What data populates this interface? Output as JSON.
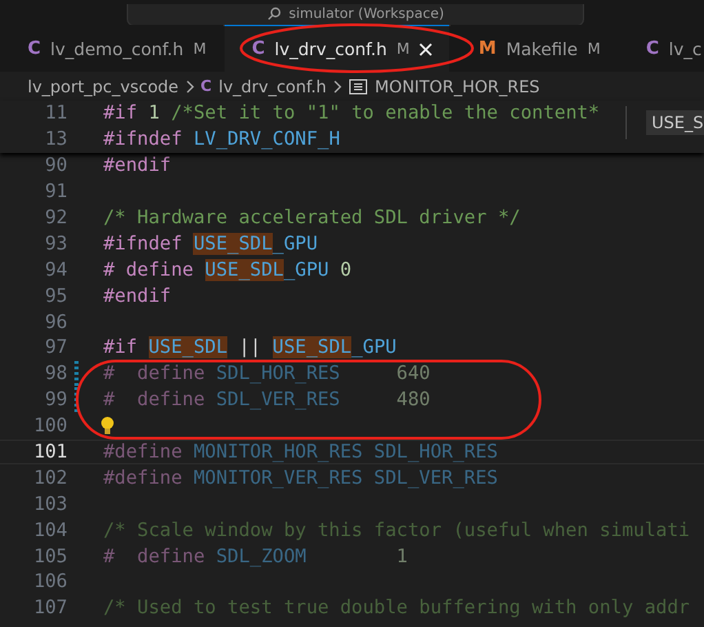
{
  "title_bar": {
    "search_text": "simulator (Workspace)"
  },
  "tabs": [
    {
      "icon": "C",
      "color": "#a074c4",
      "label": "lv_demo_conf.h",
      "status": "M",
      "selected": false
    },
    {
      "icon": "C",
      "color": "#a074c4",
      "label": "lv_drv_conf.h",
      "status": "M",
      "selected": true
    },
    {
      "icon": "M",
      "color": "#e37933",
      "label": "Makefile",
      "status": "M",
      "selected": false
    },
    {
      "icon": "C",
      "color": "#a074c4",
      "label": "lv_c",
      "selected": false
    }
  ],
  "breadcrumb": [
    {
      "kind": "folder",
      "label": "lv_port_pc_vscode"
    },
    {
      "kind": "file",
      "icon": "C",
      "label": "lv_drv_conf.h"
    },
    {
      "kind": "symbol",
      "label": "MONITOR_HOR_RES"
    }
  ],
  "sticky_lines": [
    {
      "number": "11",
      "tokens": [
        {
          "kind": "directive",
          "text": "#if"
        },
        {
          "kind": "number",
          "text": " 1"
        },
        {
          "kind": "comment",
          "text": " /*Set it to \"1\" to enable the content*"
        }
      ]
    },
    {
      "number": "13",
      "tokens": [
        {
          "kind": "directive",
          "text": "#ifndef"
        },
        {
          "kind": "macro",
          "text": " LV_DRV_CONF_H"
        }
      ]
    }
  ],
  "hover_widget": {
    "text": "USE_S"
  },
  "lines": [
    {
      "number": "90",
      "tokens": [
        {
          "kind": "directive",
          "text": "#endif"
        }
      ]
    },
    {
      "number": "91"
    },
    {
      "number": "92",
      "tokens": [
        {
          "kind": "comment",
          "text": "/* Hardware accelerated SDL driver */"
        }
      ]
    },
    {
      "number": "93",
      "tokens": [
        {
          "kind": "directive",
          "text": "#ifndef "
        },
        {
          "kind": "macro",
          "text": "USE_SDL",
          "highlight": true
        },
        {
          "kind": "macro",
          "text": "_GPU"
        }
      ]
    },
    {
      "number": "94",
      "tokens": [
        {
          "kind": "directive",
          "text": "# define "
        },
        {
          "kind": "macro",
          "text": "USE_SDL",
          "highlight": true
        },
        {
          "kind": "macro",
          "text": "_GPU "
        },
        {
          "kind": "number",
          "text": "0"
        }
      ]
    },
    {
      "number": "95",
      "tokens": [
        {
          "kind": "directive",
          "text": "#endif"
        }
      ]
    },
    {
      "number": "96"
    },
    {
      "number": "97",
      "tokens": [
        {
          "kind": "directive",
          "text": "#if "
        },
        {
          "kind": "macro",
          "text": "USE_SDL",
          "highlight": true
        },
        {
          "kind": "text",
          "text": " || "
        },
        {
          "kind": "macro",
          "text": "USE_SDL",
          "highlight": true
        },
        {
          "kind": "macro",
          "text": "_GPU"
        }
      ]
    },
    {
      "number": "98",
      "inactive": true,
      "modified": true,
      "tokens": [
        {
          "kind": "directive",
          "text": "#  define "
        },
        {
          "kind": "macro",
          "text": "SDL_HOR_RES"
        },
        {
          "kind": "number",
          "text": "     640"
        }
      ]
    },
    {
      "number": "99",
      "inactive": true,
      "modified": true,
      "tokens": [
        {
          "kind": "directive",
          "text": "#  define "
        },
        {
          "kind": "macro",
          "text": "SDL_VER_RES"
        },
        {
          "kind": "number",
          "text": "     480"
        }
      ]
    },
    {
      "number": "100",
      "lightbulb": true
    },
    {
      "number": "101",
      "inactive": true,
      "current": true,
      "tokens": [
        {
          "kind": "directive",
          "text": "#define "
        },
        {
          "kind": "macro",
          "text": "MONITOR_HOR_RES SDL_HOR_RES"
        }
      ]
    },
    {
      "number": "102",
      "inactive": true,
      "tokens": [
        {
          "kind": "directive",
          "text": "#define "
        },
        {
          "kind": "macro",
          "text": "MONITOR_VER_RES SDL_VER_RES"
        }
      ]
    },
    {
      "number": "103"
    },
    {
      "number": "104",
      "inactive": true,
      "tokens": [
        {
          "kind": "comment",
          "text": "/* Scale window by this factor (useful when simulati"
        }
      ]
    },
    {
      "number": "105",
      "inactive": true,
      "tokens": [
        {
          "kind": "directive",
          "text": "#  define "
        },
        {
          "kind": "macro",
          "text": "SDL_ZOOM"
        },
        {
          "kind": "number",
          "text": "        1"
        }
      ]
    },
    {
      "number": "106"
    },
    {
      "number": "107",
      "inactive": true,
      "tokens": [
        {
          "kind": "comment",
          "text": "/* Used to test true double buffering with only addr"
        }
      ]
    }
  ],
  "annotations": [
    {
      "kind": "ellipse"
    },
    {
      "kind": "ellipse"
    }
  ]
}
